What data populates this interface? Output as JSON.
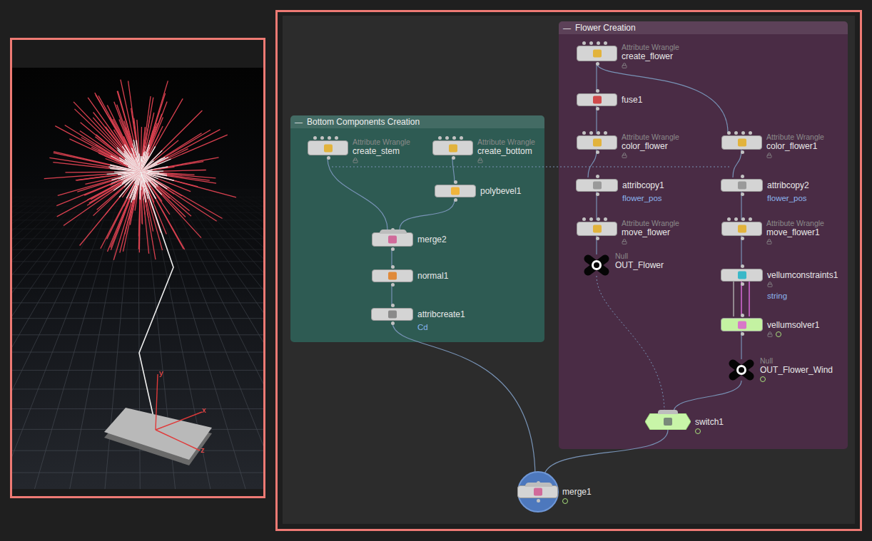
{
  "viewport": {
    "axes": [
      {
        "label": "y"
      },
      {
        "label": "x"
      },
      {
        "label": "z"
      }
    ]
  },
  "network_boxes": [
    {
      "toggle": "—",
      "title": "Bottom Components Creation",
      "color": "#2e5b53"
    },
    {
      "toggle": "—",
      "title": "Flower Creation",
      "color": "#4a2c45"
    }
  ],
  "nodes": [
    {
      "name": "create_stem",
      "type": "Attribute Wrangle",
      "kind": "wrangle",
      "color": "#e2b33c",
      "locked": true,
      "highlighted": false,
      "selected": false,
      "flag": false
    },
    {
      "name": "create_bottom",
      "type": "Attribute Wrangle",
      "kind": "wrangle",
      "color": "#e2b33c",
      "locked": true,
      "highlighted": false,
      "selected": false,
      "flag": false
    },
    {
      "name": "polybevel1",
      "kind": "sop",
      "color": "#f0b43c",
      "locked": false,
      "highlighted": false,
      "selected": false,
      "flag": false
    },
    {
      "name": "merge2",
      "kind": "merge",
      "color": "#d06a9a",
      "locked": false,
      "highlighted": false,
      "selected": false,
      "flag": false
    },
    {
      "name": "normal1",
      "kind": "sop",
      "color": "#e08a3a",
      "locked": false,
      "highlighted": false,
      "selected": false,
      "flag": false
    },
    {
      "name": "attribcreate1",
      "annotation": "Cd",
      "kind": "sop",
      "color": "#8a8a8a",
      "locked": false,
      "highlighted": false,
      "selected": false,
      "flag": false
    },
    {
      "name": "create_flower",
      "type": "Attribute Wrangle",
      "kind": "wrangle",
      "color": "#e2b33c",
      "locked": true,
      "highlighted": false,
      "selected": false,
      "flag": false
    },
    {
      "name": "fuse1",
      "kind": "sop",
      "color": "#d04a4a",
      "locked": false,
      "highlighted": false,
      "selected": false,
      "flag": false
    },
    {
      "name": "color_flower",
      "type": "Attribute Wrangle",
      "kind": "wrangle",
      "color": "#e2b33c",
      "locked": true,
      "highlighted": false,
      "selected": false,
      "flag": false
    },
    {
      "name": "color_flower1",
      "type": "Attribute Wrangle",
      "kind": "wrangle",
      "color": "#e2b33c",
      "locked": true,
      "highlighted": false,
      "selected": false,
      "flag": false
    },
    {
      "name": "attribcopy1",
      "annotation": "flower_pos",
      "kind": "sop",
      "color": "#9a9a9a",
      "locked": false,
      "highlighted": false,
      "selected": false,
      "flag": false
    },
    {
      "name": "attribcopy2",
      "annotation": "flower_pos",
      "kind": "sop",
      "color": "#9a9a9a",
      "locked": false,
      "highlighted": false,
      "selected": false,
      "flag": false
    },
    {
      "name": "move_flower",
      "type": "Attribute Wrangle",
      "kind": "wrangle",
      "color": "#e2b33c",
      "locked": true,
      "highlighted": false,
      "selected": false,
      "flag": false
    },
    {
      "name": "move_flower1",
      "type": "Attribute Wrangle",
      "kind": "wrangle",
      "color": "#e2b33c",
      "locked": true,
      "highlighted": false,
      "selected": false,
      "flag": false
    },
    {
      "name": "OUT_Flower",
      "type": "Null",
      "kind": "null",
      "color": "#000000",
      "locked": false,
      "highlighted": false,
      "selected": false,
      "flag": false
    },
    {
      "name": "vellumconstraints1",
      "annotation": "string",
      "kind": "sop",
      "color": "#3ab8c8",
      "locked": true,
      "highlighted": false,
      "selected": false,
      "flag": false
    },
    {
      "name": "vellumsolver1",
      "kind": "sop",
      "color": "#d878c8",
      "locked": true,
      "highlighted": true,
      "selected": false,
      "flag": true
    },
    {
      "name": "OUT_Flower_Wind",
      "type": "Null",
      "kind": "null",
      "color": "#000000",
      "locked": false,
      "highlighted": false,
      "selected": false,
      "flag": true
    },
    {
      "name": "switch1",
      "kind": "switch",
      "color": "#7a8a7a",
      "locked": false,
      "highlighted": true,
      "selected": false,
      "flag": true
    },
    {
      "name": "merge1",
      "kind": "merge",
      "color": "#d06a9a",
      "locked": false,
      "highlighted": false,
      "selected": true,
      "flag": true
    }
  ]
}
